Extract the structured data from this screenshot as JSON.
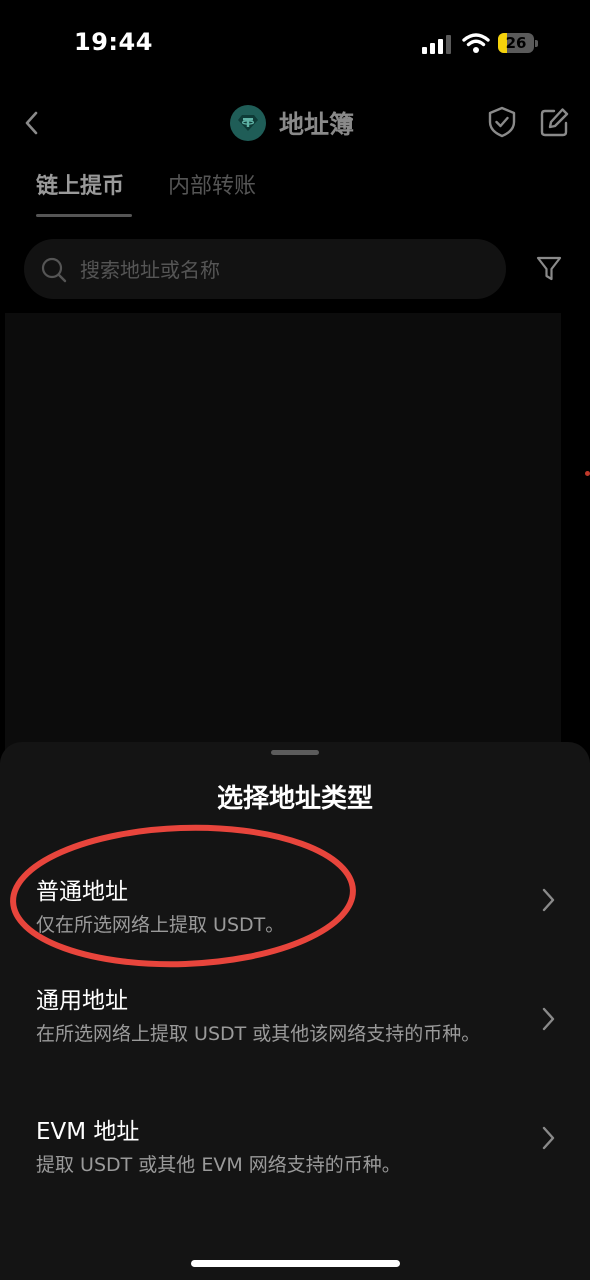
{
  "status": {
    "time": "19:44",
    "battery": "26",
    "battery_level": 0.26
  },
  "header": {
    "title": "地址簿"
  },
  "tabs": [
    {
      "label": "链上提币",
      "active": true
    },
    {
      "label": "内部转账",
      "active": false
    }
  ],
  "search": {
    "placeholder": "搜索地址或名称"
  },
  "sheet": {
    "title": "选择地址类型",
    "options": [
      {
        "title": "普通地址",
        "description": "仅在所选网络上提取 USDT。"
      },
      {
        "title": "通用地址",
        "description": "在所选网络上提取 USDT 或其他该网络支持的币种。"
      },
      {
        "title": "EVM 地址",
        "description": "提取 USDT 或其他 EVM 网络支持的币种。"
      }
    ]
  },
  "colors": {
    "highlight_circle": "#e8453c",
    "tether_green": "#1f5d57",
    "battery_yellow": "#f5d20b"
  },
  "icons": [
    "back-icon",
    "tether-icon",
    "shield-check-icon",
    "edit-icon",
    "search-icon",
    "filter-icon",
    "chevron-right-icon",
    "cellular-signal-icon",
    "wifi-icon",
    "battery-icon"
  ]
}
